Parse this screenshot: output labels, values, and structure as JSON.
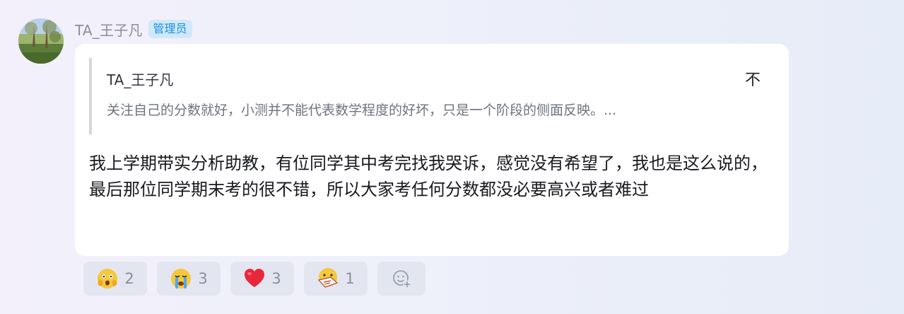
{
  "author": {
    "name": "TA_王子凡",
    "badge": "管理员"
  },
  "quote": {
    "author": "TA_王子凡",
    "text": "关注自己的分数就好，小测并不能代表数学程度的好坏，只是一个阶段的侧面反映。...",
    "toggle_glyph": "不"
  },
  "comment": {
    "text": "我上学期带实分析助教，有位同学其中考完找我哭诉，感觉没有希望了，我也是这么说的，最后那位同学期末考的很不错，所以大家考任何分数都没必要高兴或者难过"
  },
  "reactions": [
    {
      "icon": "scared-face-icon",
      "count": "2"
    },
    {
      "icon": "crying-face-icon",
      "count": "3"
    },
    {
      "icon": "red-heart-icon",
      "count": "3"
    },
    {
      "icon": "newspaper-face-icon",
      "count": "1"
    }
  ],
  "colors": {
    "badge_bg": "#cfe9fb",
    "badge_text": "#1a8fe0",
    "reaction_bg": "#e3e6f1"
  }
}
